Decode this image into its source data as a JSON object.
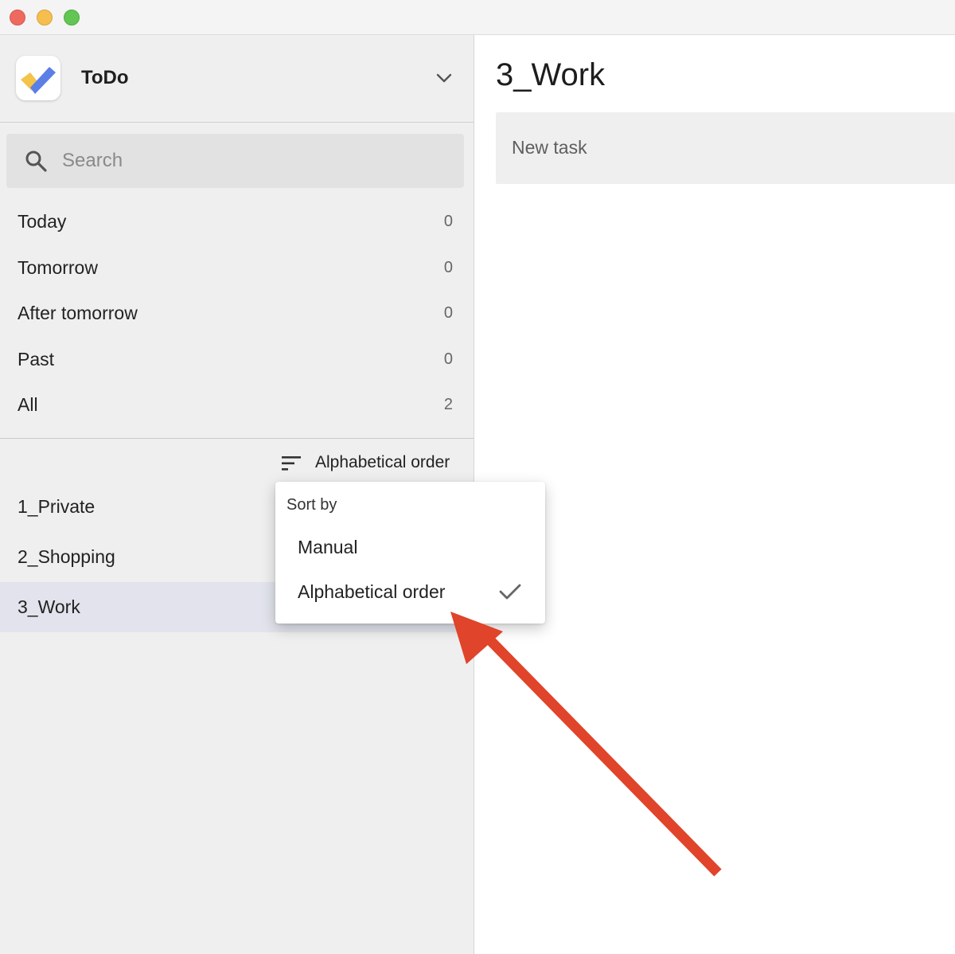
{
  "app": {
    "name": "ToDo"
  },
  "search": {
    "placeholder": "Search"
  },
  "filters": [
    {
      "label": "Today",
      "count": "0"
    },
    {
      "label": "Tomorrow",
      "count": "0"
    },
    {
      "label": "After tomorrow",
      "count": "0"
    },
    {
      "label": "Past",
      "count": "0"
    },
    {
      "label": "All",
      "count": "2"
    }
  ],
  "sort": {
    "current": "Alphabetical order"
  },
  "lists": [
    {
      "label": "1_Private"
    },
    {
      "label": "2_Shopping"
    },
    {
      "label": "3_Work",
      "selected": true
    }
  ],
  "main": {
    "title": "3_Work",
    "new_task_placeholder": "New task"
  },
  "sort_menu": {
    "header": "Sort by",
    "options": [
      {
        "label": "Manual",
        "checked": false
      },
      {
        "label": "Alphabetical order",
        "checked": true
      }
    ]
  },
  "colors": {
    "annotation_arrow": "#e0442a",
    "logo_yellow": "#f3c34a",
    "logo_blue": "#5b7fe6",
    "selected_row": "#e2e3ec"
  },
  "icons": {
    "logo": "todo-check-logo",
    "chevron": "chevron-down-icon",
    "search": "search-icon",
    "sort": "sort-icon",
    "check": "check-icon"
  }
}
